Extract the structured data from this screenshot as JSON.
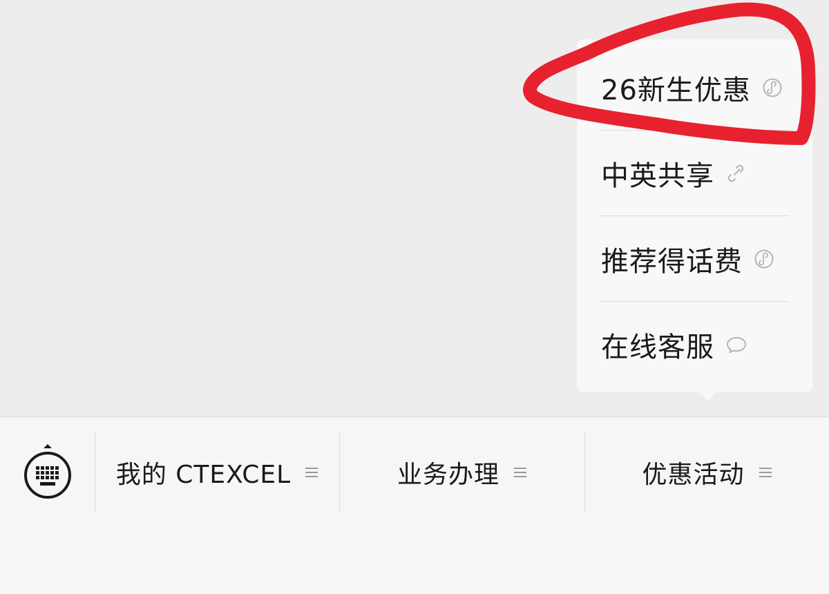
{
  "popup_menu": {
    "items": [
      {
        "label": "26新生优惠",
        "icon": "mini-program-icon"
      },
      {
        "label": "中英共享",
        "icon": "link-icon"
      },
      {
        "label": "推荐得话费",
        "icon": "mini-program-icon"
      },
      {
        "label": "在线客服",
        "icon": "chat-bubble-icon"
      }
    ]
  },
  "bottom_menu": {
    "keyboard_icon": "keyboard-icon",
    "tabs": [
      {
        "label": "我的 CTEXCEL",
        "icon": "menu-lines-icon"
      },
      {
        "label": "业务办理",
        "icon": "menu-lines-icon"
      },
      {
        "label": "优惠活动",
        "icon": "menu-lines-icon"
      }
    ]
  },
  "colors": {
    "annotation": "#e8212f",
    "background": "#ededed",
    "menu_background": "#f8f8f8",
    "bar_background": "#f6f6f6"
  }
}
